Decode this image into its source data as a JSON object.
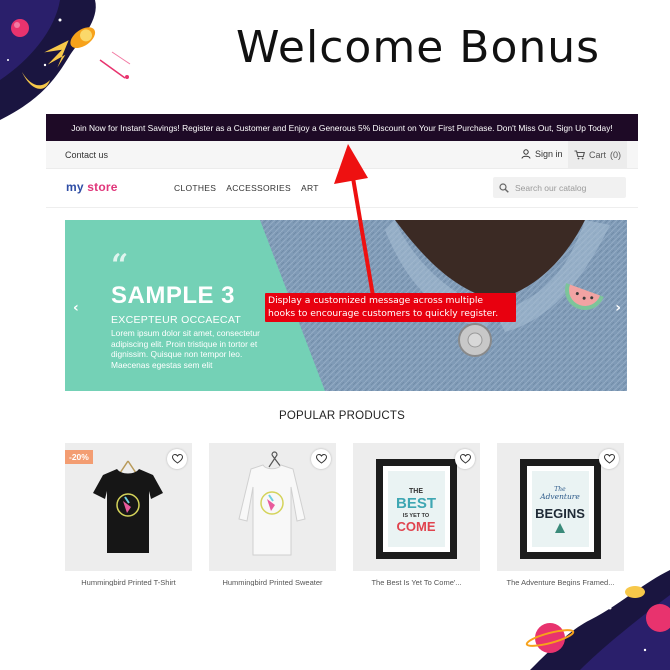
{
  "promo": {
    "title": "Welcome Bonus"
  },
  "banner": {
    "message": "Join Now for Instant Savings! Register as a Customer and Enjoy a Generous 5% Discount on Your First Purchase. Don't Miss Out, Sign Up Today!"
  },
  "topbar": {
    "contact_label": "Contact us",
    "signin_label": "Sign in",
    "cart_label": "Cart",
    "cart_count": "(0)"
  },
  "header": {
    "logo_word1": "my",
    "logo_word2": "store",
    "nav": [
      "CLOTHES",
      "ACCESSORIES",
      "ART"
    ],
    "search_placeholder": "Search our catalog"
  },
  "hero": {
    "quote_mark": "“",
    "title": "SAMPLE 3",
    "subtitle": "EXCEPTEUR OCCAECAT",
    "text": "Lorem ipsum dolor sit amet, consectetur adipiscing elit. Proin tristique in tortor et dignissim. Quisque non tempor leo. Maecenas egestas sem elit",
    "prev_arrow": "‹",
    "next_arrow": "›"
  },
  "callout": {
    "text": "Display a customized message across multiple hooks to encourage customers to quickly register."
  },
  "section": {
    "title": "POPULAR PRODUCTS"
  },
  "products": [
    {
      "name": "Hummingbird Printed T-Shirt",
      "badge": "-20%"
    },
    {
      "name": "Hummingbird Printed Sweater",
      "badge": ""
    },
    {
      "name": "The Best Is Yet To Come'...",
      "badge": ""
    },
    {
      "name": "The Adventure Begins Framed...",
      "badge": ""
    }
  ],
  "posters": {
    "best_line1": "THE",
    "best_line2": "BEST",
    "best_line3": "IS YET TO",
    "best_line4": "COME",
    "adv_line1": "The",
    "adv_line2": "Adventure",
    "adv_line3": "BEGINS"
  },
  "colors": {
    "banner_bg": "#1e0a26",
    "hero_mint": "#74d1b6",
    "callout_red": "#e8000f",
    "badge": "#f39d72"
  }
}
